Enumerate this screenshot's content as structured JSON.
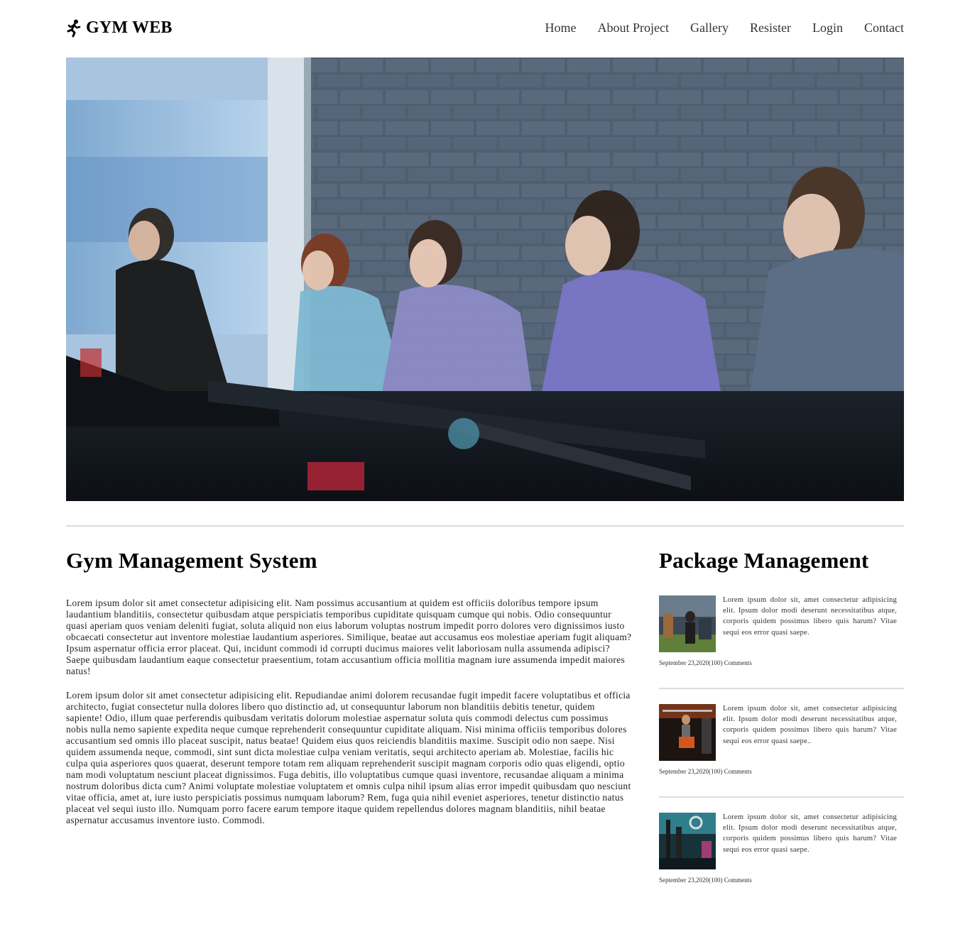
{
  "brand": {
    "name": "GYM WEB",
    "icon": "runner-icon"
  },
  "nav": [
    {
      "label": "Home"
    },
    {
      "label": "About Project"
    },
    {
      "label": "Gallery"
    },
    {
      "label": "Resister"
    },
    {
      "label": "Login"
    },
    {
      "label": "Contact"
    }
  ],
  "hero": {
    "image": "hero-photo-spin-class"
  },
  "main": {
    "title": "Gym Management System",
    "paragraphs": [
      "Lorem ipsum dolor sit amet consectetur adipisicing elit. Nam possimus accusantium at quidem est officiis doloribus tempore ipsum laudantium blanditiis, consectetur quibusdam atque perspiciatis temporibus cupiditate quisquam cumque qui nobis. Odio consequuntur quasi aperiam quos veniam deleniti fugiat, soluta aliquid non eius laborum voluptas nostrum impedit porro dolores vero dignissimos iusto obcaecati consectetur aut inventore molestiae laudantium asperiores. Similique, beatae aut accusamus eos molestiae aperiam fugit aliquam? Ipsum aspernatur officia error placeat. Qui, incidunt commodi id corrupti ducimus maiores velit laboriosam nulla assumenda adipisci? Saepe quibusdam laudantium eaque consectetur praesentium, totam accusantium officia mollitia magnam iure assumenda impedit maiores natus!",
      "Lorem ipsum dolor sit amet consectetur adipisicing elit. Repudiandae animi dolorem recusandae fugit impedit facere voluptatibus et officia architecto, fugiat consectetur nulla dolores libero quo distinctio ad, ut consequuntur laborum non blanditiis debitis tenetur, quidem sapiente! Odio, illum quae perferendis quibusdam veritatis dolorum molestiae aspernatur soluta quis commodi delectus cum possimus nobis nulla nemo sapiente expedita neque cumque reprehenderit consequuntur cupiditate aliquam. Nisi minima officiis temporibus dolores accusantium sed omnis illo placeat suscipit, natus beatae! Quidem eius quos reiciendis blanditiis maxime. Suscipit odio non saepe. Nisi quidem assumenda neque, commodi, sint sunt dicta molestiae culpa veniam veritatis, sequi architecto aperiam ab. Molestiae, facilis hic culpa quia asperiores quos quaerat, deserunt tempore totam rem aliquam reprehenderit suscipit magnam corporis odio quas eligendi, optio nam modi voluptatum nesciunt placeat dignissimos. Fuga debitis, illo voluptatibus cumque quasi inventore, recusandae aliquam a minima nostrum doloribus dicta cum? Animi voluptate molestiae voluptatem et omnis culpa nihil ipsum alias error impedit quibusdam quo nesciunt vitae officia, amet at, iure iusto perspiciatis possimus numquam laborum? Rem, fuga quia nihil eveniet asperiores, tenetur distinctio natus placeat vel sequi iusto illo. Numquam porro facere earum tempore itaque quidem repellendus dolores magnam blanditiis, nihil beatae aspernatur accusamus inventore iusto. Commodi."
    ]
  },
  "sidebar": {
    "title": "Package Management",
    "packages": [
      {
        "text": "Lorem ipsum dolor sit, amet consectetur adipisicing elit. Ipsum dolor modi deserunt necessitatibus atque, corporis quidem possimus libero quis harum? Vitae sequi eos error quasi saepe.",
        "meta": "September 23,2020(100) Comments",
        "image": "gym-interior-thumbnail"
      },
      {
        "text": "Lorem ipsum dolor sit, amet consectetur adipisicing elit. Ipsum dolor modi deserunt necessitatibus atque, corporis quidem possimus libero quis harum? Vitae sequi eos error quasi saepe..",
        "meta": "September 23,2020(100) Comments",
        "image": "weightlifting-thumbnail"
      },
      {
        "text": "Lorem ipsum dolor sit, amet consectetur adipisicing elit. Ipsum dolor modi deserunt necessitatibus atque, corporis quidem possimus libero quis harum? Vitae sequi eos error quasi saepe.",
        "meta": "September 23,2020(100) Comments",
        "image": "gym-equipment-thumbnail"
      }
    ]
  }
}
